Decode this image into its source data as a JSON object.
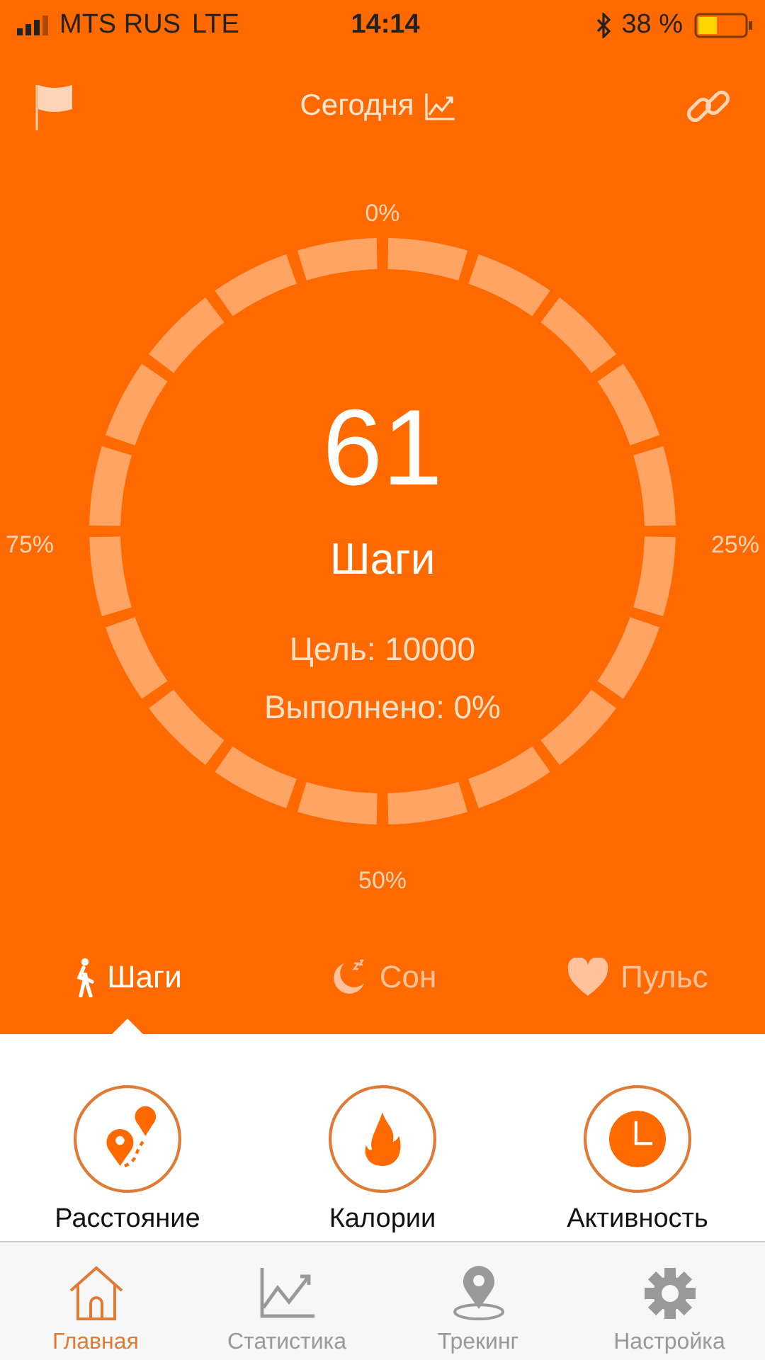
{
  "status_bar": {
    "carrier": "MTS RUS",
    "network": "LTE",
    "time": "14:14",
    "battery": "38 %"
  },
  "header": {
    "title": "Сегодня"
  },
  "ring": {
    "labels": [
      "0%",
      "25%",
      "50%",
      "75%"
    ],
    "value": "61",
    "unit": "Шаги",
    "goal": "Цель: 10000",
    "done": "Выполнено: 0%"
  },
  "tabs": [
    {
      "kind": "steps",
      "label": "Шаги",
      "selected": true
    },
    {
      "kind": "sleep",
      "label": "Сон",
      "selected": false
    },
    {
      "kind": "pulse",
      "label": "Пульс",
      "selected": false
    }
  ],
  "metrics": [
    {
      "kind": "distance",
      "label": "Расстояние"
    },
    {
      "kind": "calories",
      "label": "Калории"
    },
    {
      "kind": "activity",
      "label": "Активность"
    }
  ],
  "nav": [
    {
      "kind": "home",
      "label": "Главная",
      "selected": true
    },
    {
      "kind": "stats",
      "label": "Статистика",
      "selected": false
    },
    {
      "kind": "tracking",
      "label": "Трекинг",
      "selected": false
    },
    {
      "kind": "settings",
      "label": "Настройка",
      "selected": false
    }
  ]
}
